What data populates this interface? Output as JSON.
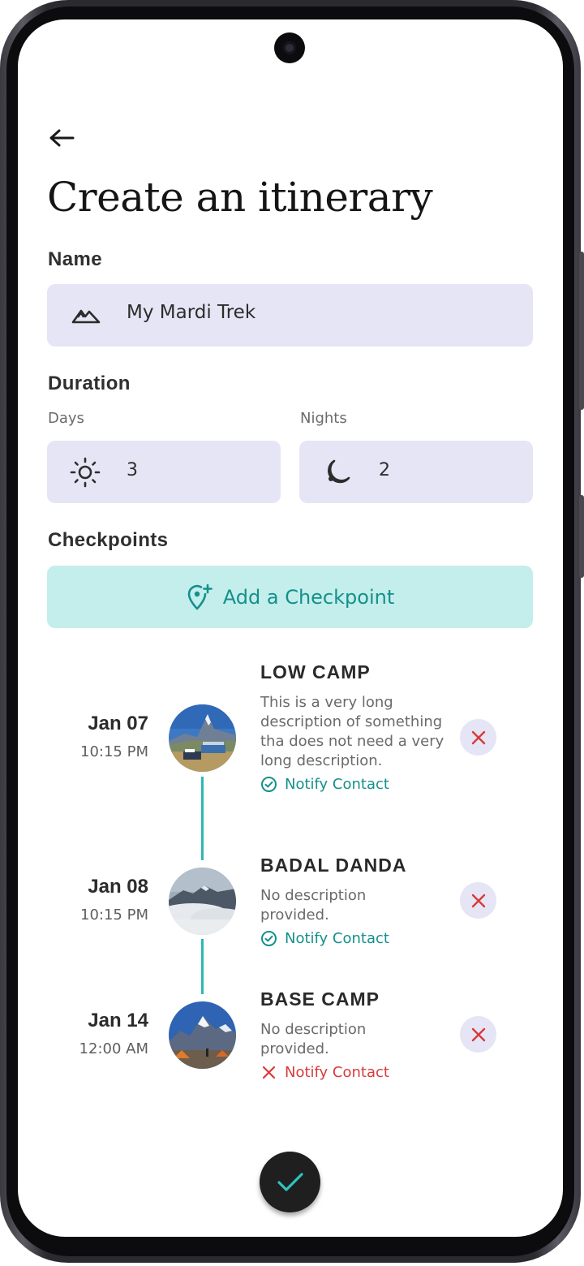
{
  "page": {
    "title": "Create an itinerary",
    "back_icon": "arrow-left-icon"
  },
  "name_section": {
    "label": "Name",
    "value": "My Mardi Trek",
    "icon": "mountain-icon"
  },
  "duration_section": {
    "label": "Duration",
    "days": {
      "label": "Days",
      "value": "3",
      "icon": "sun-icon"
    },
    "nights": {
      "label": "Nights",
      "value": "2",
      "icon": "moon-icon"
    }
  },
  "checkpoints_section": {
    "label": "Checkpoints",
    "add_button_label": "Add a Checkpoint",
    "add_button_icon": "location-pin-plus-icon",
    "items": [
      {
        "date": "Jan 07",
        "time": "10:15 PM",
        "title": "LOW CAMP",
        "description": "This is a very long description of something tha does not need a very long description.",
        "notify_label": "Notify Contact",
        "notify_enabled": true
      },
      {
        "date": "Jan 08",
        "time": "10:15 PM",
        "title": "BADAL DANDA",
        "description": "No description provided.",
        "notify_label": "Notify Contact",
        "notify_enabled": true
      },
      {
        "date": "Jan 14",
        "time": "12:00 AM",
        "title": "BASE CAMP",
        "description": "No description provided.",
        "notify_label": "Notify Contact",
        "notify_enabled": false
      }
    ]
  },
  "colors": {
    "field_bg": "#e6e5f5",
    "accent_teal": "#15908a",
    "add_button_bg": "#c3eeec",
    "error_red": "#d93a3a",
    "fab_bg": "#1f1f1f"
  },
  "fab_icon": "check-icon"
}
